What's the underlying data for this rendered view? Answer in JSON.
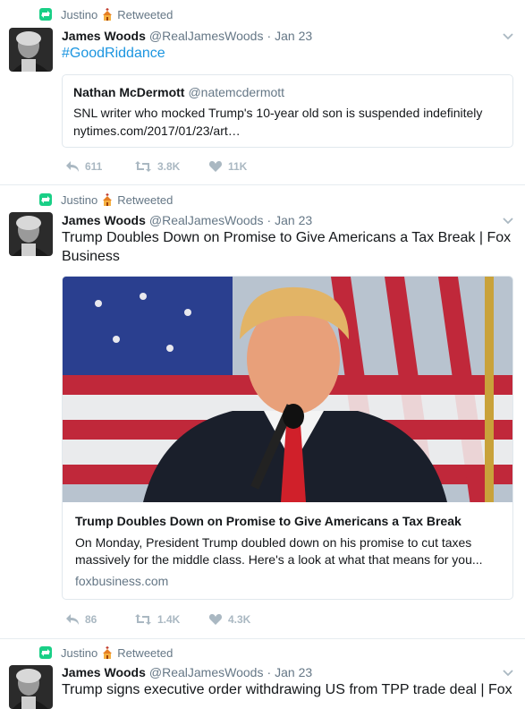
{
  "tweets": [
    {
      "retweeter": "Justino",
      "retweeted_label": "Retweeted",
      "name": "James Woods",
      "handle": "@RealJamesWoods",
      "date": "Jan 23",
      "text": "#GoodRiddance",
      "quote": {
        "name": "Nathan McDermott",
        "handle": "@natemcdermott",
        "text": "SNL writer who mocked Trump's 10-year old son is suspended indefinitely",
        "link": "nytimes.com/2017/01/23/art…"
      },
      "replies": "611",
      "retweets": "3.8K",
      "likes": "11K"
    },
    {
      "retweeter": "Justino",
      "retweeted_label": "Retweeted",
      "name": "James Woods",
      "handle": "@RealJamesWoods",
      "date": "Jan 23",
      "text": "Trump Doubles Down on Promise to Give Americans a Tax Break | Fox Business",
      "card": {
        "title": "Trump Doubles Down on Promise to Give Americans a Tax Break",
        "description": "On Monday, President Trump doubled down on his promise to cut taxes massively for the middle class. Here's a look at what that means for you...",
        "domain": "foxbusiness.com"
      },
      "replies": "86",
      "retweets": "1.4K",
      "likes": "4.3K"
    },
    {
      "retweeter": "Justino",
      "retweeted_label": "Retweeted",
      "name": "James Woods",
      "handle": "@RealJamesWoods",
      "date": "Jan 23",
      "text": "Trump signs executive order withdrawing US from TPP trade deal | Fox"
    }
  ],
  "colors": {
    "link": "#1b95e0",
    "retweet_green": "#19cf86",
    "muted": "#657786",
    "action": "#aab8c2"
  },
  "icons": [
    "retweet-icon",
    "reply-icon",
    "like-icon",
    "chevron-down-icon"
  ]
}
